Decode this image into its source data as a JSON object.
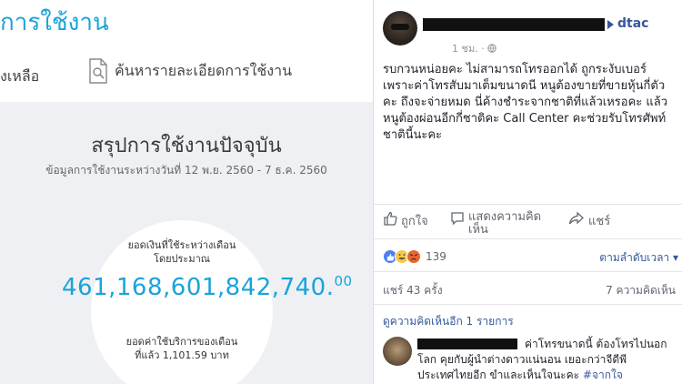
{
  "left_panel": {
    "title": "การใช้งาน",
    "nav_balance": "งเหลือ",
    "nav_search": "ค้นหารายละเอียดการใช้งาน",
    "summary_title": "สรุปการใช้งานปัจจุบัน",
    "date_range": "ข้อมูลการใช้งานระหว่างวันที่ 12 พ.ย. 2560 - 7 ธ.ค. 2560",
    "month_label_line1": "ยอดเงินที่ใช้ระหว่างเดือน",
    "month_label_line2": "โดยประมาณ",
    "amount_main": "461,168,601,842,740.",
    "amount_decimal": "00",
    "last_label_line1": "ยอดค่าใช้บริการของเดือน",
    "last_label_line2": "ที่แล้ว 1,101.59 บาท"
  },
  "right_panel": {
    "page_name": "dtac",
    "post_time": "1 ชม. · ",
    "globe_icon": "globe-icon",
    "post_text": "รบกวนหน่อยคะ ไม่สามารถโทรออกได้ ถูกระงับเบอร์ เพราะค่าโทรสับมาเต็มขนาดนี หนูต้องขายที่ขายหุ้นกี่ตัวคะ ถึงจะจ่ายหมด นี่ค้างชำระจากชาติที่แล้วเหรอคะ แล้วหนูต้องผ่อนอีกกี่ชาติคะ Call Center คะช่วยรับโทรศัพท์ชาตินี้นะคะ",
    "action_like": "ถูกใจ",
    "action_comment_line1": "แสดงความคิด",
    "action_comment_line2": "เห็น",
    "action_share": "แชร์",
    "reaction_count": "139",
    "sort_label": "ตามลำดับเวลา ▾",
    "shares": "แชร์ 43 ครั้ง",
    "comments_count": "7 ความคิดเห็น",
    "more_comments": "ดูความคิดเห็นอีก 1 รายการ",
    "comment_text": "ค่าโทรขนาดนี้ ต้องโทรไปนอกโลก คุยกับผู้นำต่างดาวแน่นอน เยอะกว่าจีดีพีประเทศไทยอีก ขำและเห็นใจนะคะ ",
    "comment_tag": "#จากใจ"
  },
  "colors": {
    "dtac_blue": "#1aa3d9",
    "fb_blue": "#365899",
    "summary_bg": "#eef0f4"
  }
}
